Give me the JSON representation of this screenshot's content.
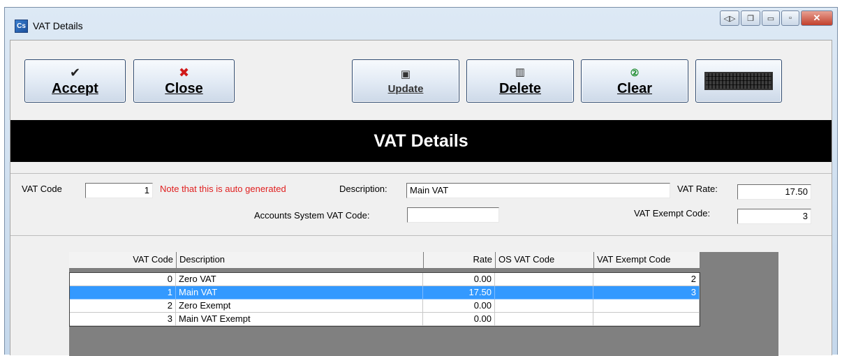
{
  "window": {
    "title": "VAT Details",
    "app_icon_text": "Cs"
  },
  "toolbar": {
    "accept": {
      "label": "Accept",
      "icon": "check-icon"
    },
    "close": {
      "label": "Close",
      "icon": "x-icon"
    },
    "update": {
      "label": "Update",
      "icon": "floppy-disk-icon"
    },
    "delete": {
      "label": "Delete",
      "icon": "trash-can-icon"
    },
    "clear": {
      "label": "Clear",
      "icon": "clear-page-icon"
    },
    "keyboard": {
      "icon": "keyboard-icon"
    }
  },
  "banner": {
    "title": "VAT Details"
  },
  "form": {
    "vat_code_label": "VAT Code",
    "vat_code_value": "1",
    "note": "Note that this is auto generated",
    "description_label": "Description:",
    "description_value": "Main VAT",
    "vat_rate_label": "VAT Rate:",
    "vat_rate_value": "17.50",
    "accounts_code_label": "Accounts System VAT Code:",
    "accounts_code_value": "",
    "exempt_code_label": "VAT Exempt Code:",
    "exempt_code_value": "3"
  },
  "grid": {
    "columns": [
      "VAT Code",
      "Description",
      "Rate",
      "OS VAT Code",
      "VAT Exempt Code"
    ],
    "rows": [
      {
        "code": "0",
        "description": "Zero VAT",
        "rate": "0.00",
        "os_code": "",
        "exempt": "2",
        "selected": false
      },
      {
        "code": "1",
        "description": "Main VAT",
        "rate": "17.50",
        "os_code": "",
        "exempt": "3",
        "selected": true
      },
      {
        "code": "2",
        "description": "Zero Exempt",
        "rate": "0.00",
        "os_code": "",
        "exempt": "",
        "selected": false
      },
      {
        "code": "3",
        "description": "Main VAT Exempt",
        "rate": "0.00",
        "os_code": "",
        "exempt": "",
        "selected": false
      }
    ]
  },
  "colors": {
    "selection": "#3399ff",
    "note": "#e02020",
    "banner": "#000000"
  }
}
